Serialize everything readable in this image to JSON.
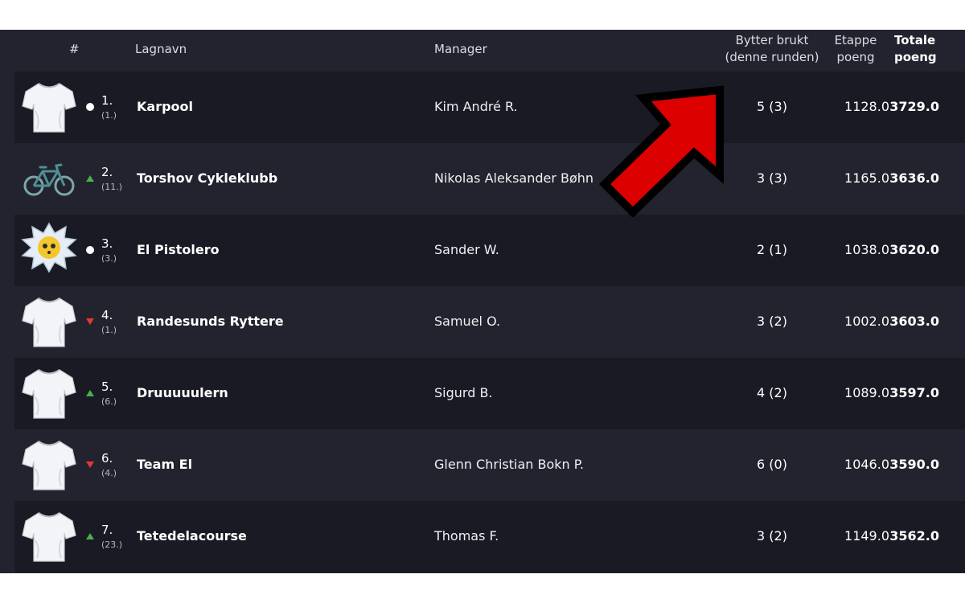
{
  "header": {
    "rank": "#",
    "team": "Lagnavn",
    "manager": "Manager",
    "subs_line1": "Bytter brukt",
    "subs_line2": "(denne runden)",
    "stage_line1": "Etappe",
    "stage_line2": "poeng",
    "total_line1": "Totale",
    "total_line2": "poeng"
  },
  "colors": {
    "up": "#4caf50",
    "down": "#e53935",
    "same": "#ffffff",
    "arrow": "#dd0000"
  },
  "rows": [
    {
      "rank": "1.",
      "prev": "(1.)",
      "move": "same",
      "icon": "tshirt-icon",
      "team": "Karpool",
      "manager": "Kim André R.",
      "subs": "5 (3)",
      "stage": "1128.0",
      "total": "3729.0"
    },
    {
      "rank": "2.",
      "prev": "(11.)",
      "move": "up",
      "icon": "bicycle-icon",
      "team": "Torshov Cykleklubb",
      "manager": "Nikolas Aleksander Bøhn",
      "subs": "3 (3)",
      "stage": "1165.0",
      "total": "3636.0"
    },
    {
      "rank": "3.",
      "prev": "(3.)",
      "move": "same",
      "icon": "explosion-face-icon",
      "team": "El Pistolero",
      "manager": "Sander W.",
      "subs": "2 (1)",
      "stage": "1038.0",
      "total": "3620.0"
    },
    {
      "rank": "4.",
      "prev": "(1.)",
      "move": "down",
      "icon": "tshirt-icon",
      "team": "Randesunds Ryttere",
      "manager": "Samuel O.",
      "subs": "3 (2)",
      "stage": "1002.0",
      "total": "3603.0"
    },
    {
      "rank": "5.",
      "prev": "(6.)",
      "move": "up",
      "icon": "tshirt-icon",
      "team": "Druuuuulern",
      "manager": "Sigurd B.",
      "subs": "4 (2)",
      "stage": "1089.0",
      "total": "3597.0"
    },
    {
      "rank": "6.",
      "prev": "(4.)",
      "move": "down",
      "icon": "tshirt-icon",
      "team": "Team El",
      "manager": "Glenn Christian Bokn P.",
      "subs": "6 (0)",
      "stage": "1046.0",
      "total": "3590.0"
    },
    {
      "rank": "7.",
      "prev": "(23.)",
      "move": "up",
      "icon": "tshirt-icon",
      "team": "Tetedelacourse",
      "manager": "Thomas F.",
      "subs": "3 (2)",
      "stage": "1149.0",
      "total": "3562.0"
    }
  ]
}
